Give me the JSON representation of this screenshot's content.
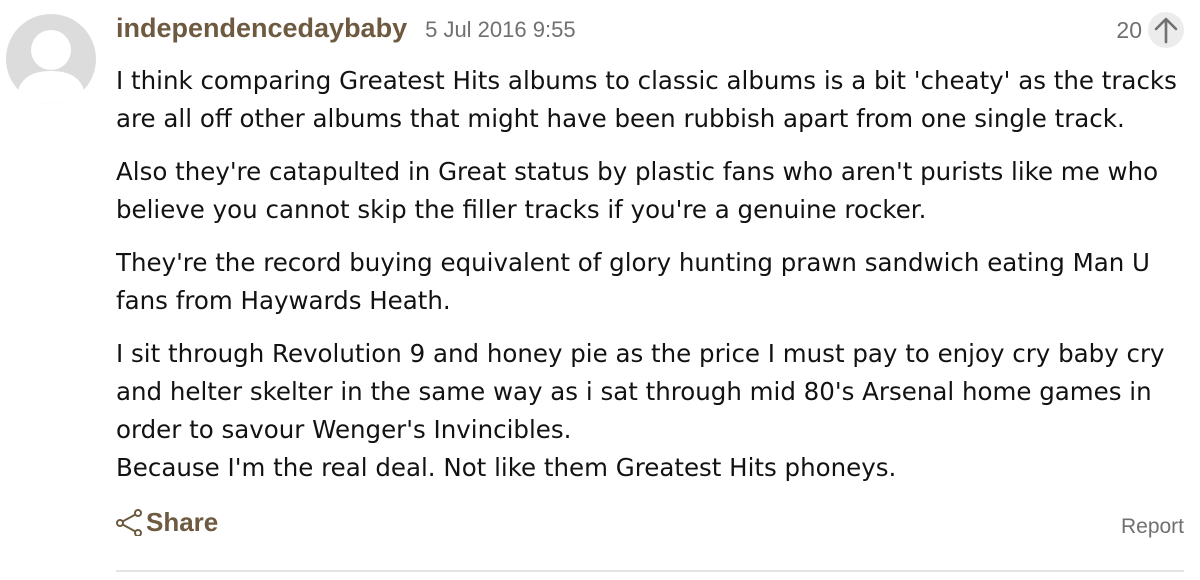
{
  "comment": {
    "username": "independencedaybaby",
    "timestamp": "5 Jul 2016 9:55",
    "recommend_count": "20",
    "paragraphs": [
      "I think comparing Greatest Hits albums to classic albums is a bit 'cheaty' as the tracks are all off other albums that might have been rubbish apart from one single track.",
      "Also they're catapulted in Great status by plastic fans who aren't purists like me who believe you cannot skip the filler tracks if you're a genuine rocker.",
      "They're the record buying equivalent of glory hunting prawn sandwich eating Man U fans from Haywards Heath.",
      "I sit through Revolution 9 and honey pie as the price I must pay to enjoy cry baby cry and helter skelter in the same way as i sat through mid 80's Arsenal home games in order to savour Wenger's Invincibles.",
      "Because I'm the real deal. Not like them Greatest Hits phoneys."
    ]
  },
  "actions": {
    "share_label": "Share",
    "report_label": "Report"
  },
  "icons": {
    "avatar": "default-avatar-icon",
    "recommend": "arrow-up-icon",
    "share": "share-icon"
  },
  "colors": {
    "username": "#6e5a41",
    "meta_text": "#707070",
    "avatar_bg": "#dcdcdc"
  }
}
